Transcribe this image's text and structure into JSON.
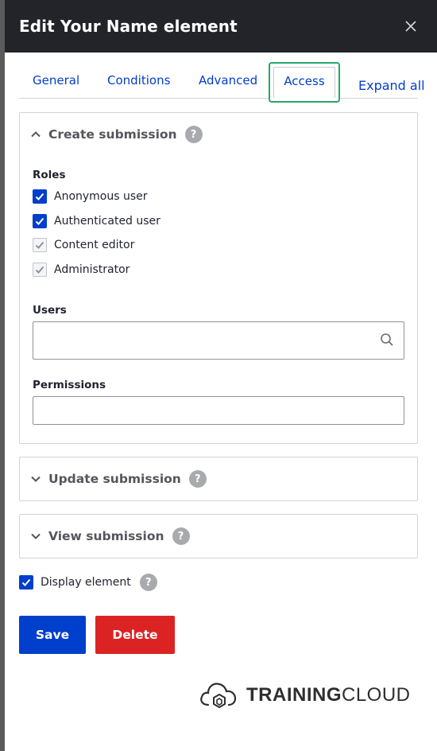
{
  "dialog": {
    "title": "Edit Your Name element",
    "close_label": "×"
  },
  "tabs": [
    {
      "label": "General",
      "active": false
    },
    {
      "label": "Conditions",
      "active": false
    },
    {
      "label": "Advanced",
      "active": false
    },
    {
      "label": "Access",
      "active": true
    }
  ],
  "expand_all_label": "Expand all",
  "create_submission": {
    "summary": "Create submission",
    "expanded": true,
    "roles_label": "Roles",
    "roles": [
      {
        "label": "Anonymous user",
        "checked": true,
        "disabled": false
      },
      {
        "label": "Authenticated user",
        "checked": true,
        "disabled": false
      },
      {
        "label": "Content editor",
        "checked": true,
        "disabled": true
      },
      {
        "label": "Administrator",
        "checked": true,
        "disabled": true
      }
    ],
    "users_label": "Users",
    "users_value": "",
    "permissions_label": "Permissions",
    "permissions_value": ""
  },
  "update_submission": {
    "summary": "Update submission",
    "expanded": false
  },
  "view_submission": {
    "summary": "View submission",
    "expanded": false
  },
  "display_element": {
    "label": "Display element",
    "checked": true
  },
  "help_glyph": "?",
  "actions": {
    "save_label": "Save",
    "delete_label": "Delete"
  },
  "logo": {
    "text_bold": "TRAINING",
    "text_light": "CLOUD"
  },
  "colors": {
    "primary": "#003ecc",
    "danger": "#dc2323",
    "focus": "#26a769",
    "titlebar": "#232429"
  }
}
